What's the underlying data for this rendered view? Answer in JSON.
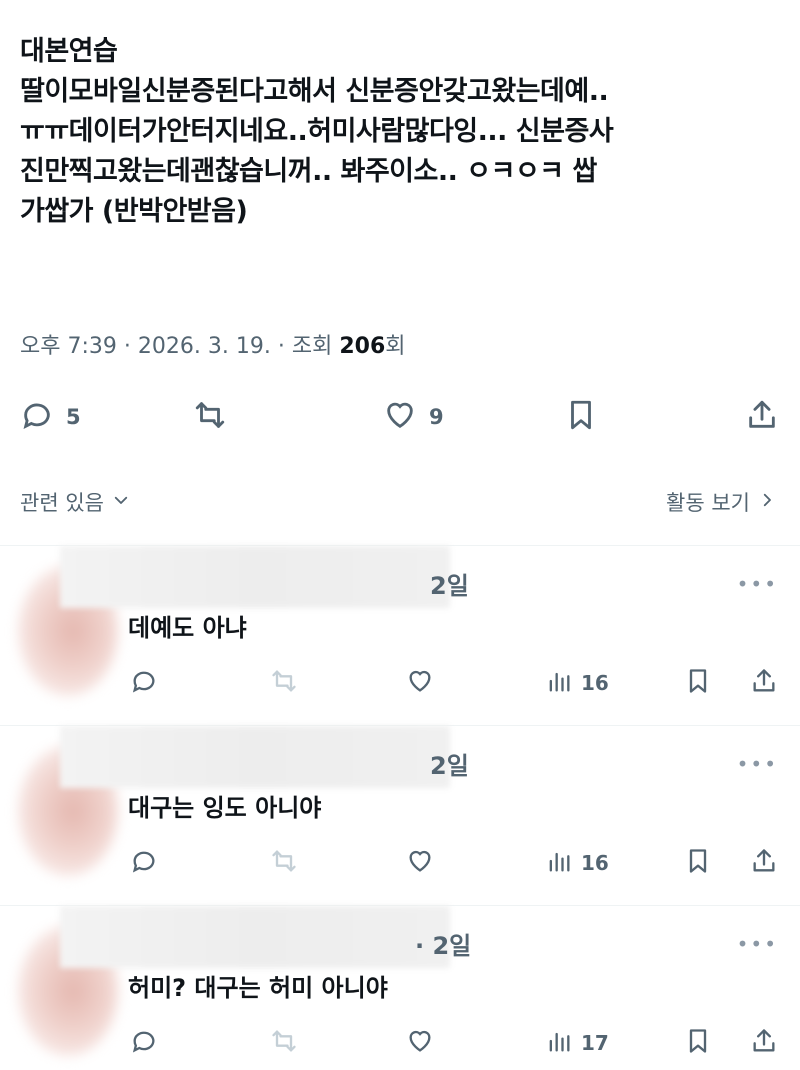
{
  "tweet": {
    "lines": [
      "대본연습",
      "딸이모바일신분증된다고해서 신분증안갖고왔는데예..",
      "ㅠㅠ데이터가안터지네요..허미사람많다잉...  신분증사",
      "진만찍고왔는데괜찮습니꺼..  봐주이소..    ㅇㅋㅇㅋ  쌉",
      "가쌉가 (반박안받음)"
    ],
    "time": "오후 7:39",
    "date": "2026. 3. 19.",
    "views_label": "조회",
    "views": "206",
    "views_suffix": "회",
    "sep": "·"
  },
  "actions": {
    "reply_count": "5",
    "like_count": "9"
  },
  "related": {
    "label": "관련 있음",
    "activity_label": "활동 보기"
  },
  "replies": [
    {
      "time": "2일",
      "text": "데예도 아냐",
      "views": "16"
    },
    {
      "time": "2일",
      "text": "대구는 잉도 아니야",
      "views": "16"
    },
    {
      "time": "· 2일",
      "text": "허미? 대구는 허미 아니야",
      "views": "17"
    }
  ],
  "icons": [
    "reply-icon",
    "retweet-icon",
    "like-icon",
    "bookmark-icon",
    "share-icon",
    "views-icon",
    "chevron-down-icon",
    "chevron-right-icon",
    "more-icon"
  ]
}
